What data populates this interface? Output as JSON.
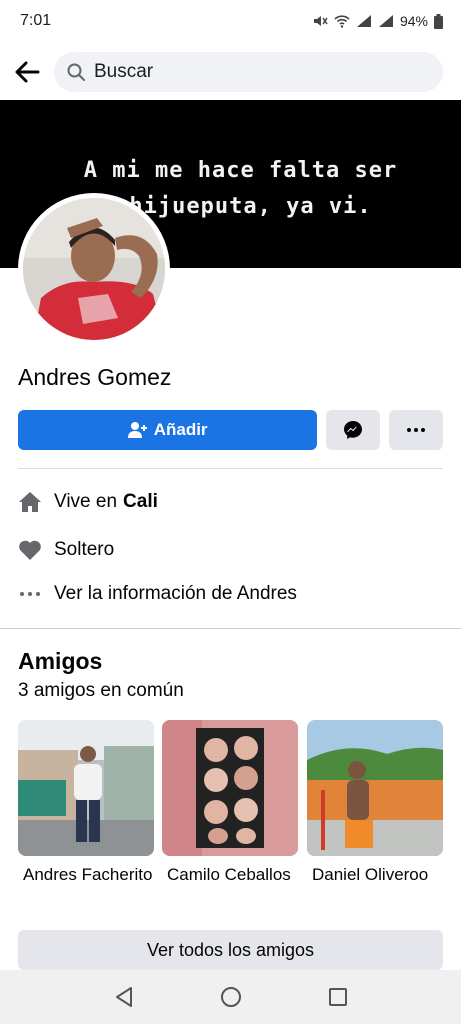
{
  "status_bar": {
    "time": "7:01",
    "battery": "94%"
  },
  "search": {
    "placeholder": "Buscar"
  },
  "cover": {
    "line1": "A mi me hace falta ser",
    "line2": "hijueputa, ya vi."
  },
  "profile": {
    "name": "Andres Gomez"
  },
  "actions": {
    "add_label": "Añadir"
  },
  "info": {
    "lives_prefix": "Vive en",
    "lives_city": "Cali",
    "relationship": "Soltero",
    "see_info": "Ver la información de Andres"
  },
  "friends": {
    "title": "Amigos",
    "mutual": "3 amigos en común",
    "items": [
      {
        "name": "Andres Facherito"
      },
      {
        "name": "Camilo Ceballos"
      },
      {
        "name": "Daniel Oliveroo"
      }
    ],
    "see_all": "Ver todos los amigos"
  },
  "colors": {
    "primary": "#1b74e4",
    "secondary": "#e4e6eb",
    "search_bg": "#f0f2f5"
  },
  "icons": [
    "back-arrow-icon",
    "search-icon",
    "add-friend-icon",
    "messenger-icon",
    "more-icon",
    "home-icon",
    "heart-icon",
    "dots-icon",
    "nav-back-icon",
    "nav-home-icon",
    "nav-recents-icon"
  ]
}
